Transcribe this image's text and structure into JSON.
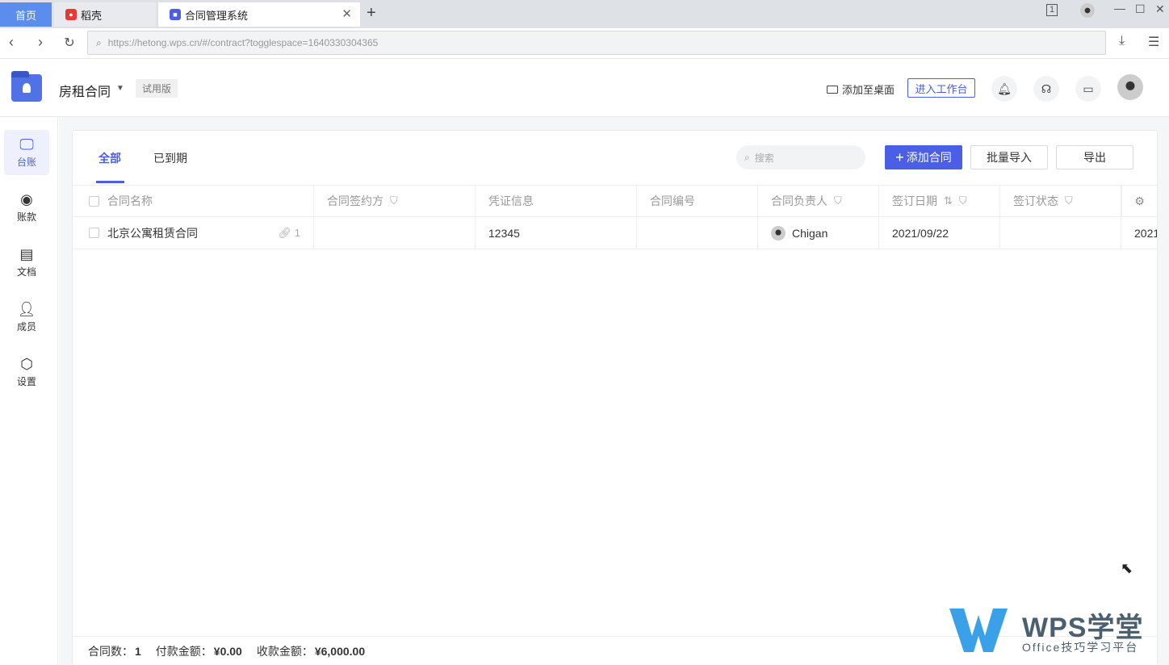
{
  "browser": {
    "tabs": [
      {
        "label": "首页"
      },
      {
        "label": "稻壳"
      },
      {
        "label": "合同管理系统"
      }
    ],
    "url": "https://hetong.wps.cn/#/contract?togglespace=1640330304365",
    "window_badge": "1"
  },
  "header": {
    "space_name": "房租合同",
    "trial_label": "试用版",
    "add_desktop_label": "添加至桌面",
    "workbench_label": "进入工作台"
  },
  "sidebar": {
    "items": [
      {
        "label": "台账",
        "icon": "ledger-icon",
        "active": true
      },
      {
        "label": "账款",
        "icon": "payment-icon",
        "active": false
      },
      {
        "label": "文档",
        "icon": "document-icon",
        "active": false
      },
      {
        "label": "成员",
        "icon": "member-icon",
        "active": false
      },
      {
        "label": "设置",
        "icon": "settings-icon",
        "active": false
      }
    ]
  },
  "toolbar": {
    "tabs": [
      {
        "label": "全部"
      },
      {
        "label": "已到期"
      }
    ],
    "search_placeholder": "搜索",
    "add_label": "添加合同",
    "import_label": "批量导入",
    "export_label": "导出"
  },
  "table": {
    "columns": [
      "合同名称",
      "合同签约方",
      "凭证信息",
      "合同编号",
      "合同负责人",
      "签订日期",
      "签订状态"
    ],
    "rows": [
      {
        "name": "北京公寓租赁合同",
        "attachments": "1",
        "party": "",
        "voucher": "12345",
        "number": "",
        "owner": "Chigan",
        "date": "2021/09/22",
        "status": "",
        "extra": "2021"
      }
    ]
  },
  "footer": {
    "count_label": "合同数：",
    "count_value": "1",
    "pay_label": "付款金额：",
    "pay_value": "¥0.00",
    "receive_label": "收款金额：",
    "receive_value": "¥6,000.00"
  },
  "watermark": {
    "title": "WPS学堂",
    "subtitle": "Office技巧学习平台"
  },
  "colors": {
    "accent": "#4a5fe6",
    "home_tab": "#5b8def"
  }
}
